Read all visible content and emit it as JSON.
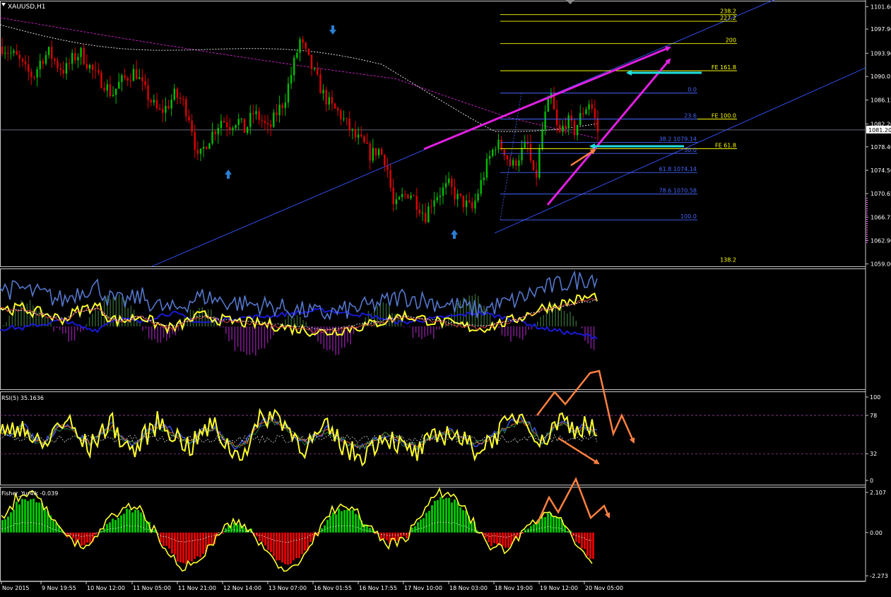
{
  "window": {
    "symbol_label": "XAUUSD,H1"
  },
  "colors": {
    "background": "#000000",
    "grid": "#ffffff",
    "bull": "#00c000",
    "bear": "#e00000",
    "fib": "#ffff00",
    "fib_retrace": "#4466ff",
    "trend": "#3355ff",
    "magenta": "#e020e0",
    "cyan": "#20e0e0",
    "orange": "#ff8040",
    "yellow_line": "#ffff00",
    "hist_green": "#00c000",
    "hist_red": "#e00000",
    "hist_purple": "#7a1a8a"
  },
  "chart_data": [
    {
      "type": "candlestick",
      "title": "XAUUSD,H1",
      "ylim": [
        1058.6,
        1102.6
      ],
      "y_ticks": [
        "1101.60",
        "1097.90",
        "1093.90",
        "1090.05",
        "1086.15",
        "1082.20",
        "1078.40",
        "1074.50",
        "1070.65",
        "1066.75",
        "1062.90",
        "1059.00"
      ],
      "current_price_label": "1081.20",
      "x_ticks": [
        "Nov 2015",
        "9 Nov 19:55",
        "10 Nov 12:00",
        "11 Nov 05:00",
        "11 Nov 21:00",
        "12 Nov 14:00",
        "13 Nov 07:00",
        "16 Nov 01:55",
        "16 Nov 17:55",
        "17 Nov 10:00",
        "18 Nov 03:00",
        "18 Nov 19:00",
        "19 Nov 12:00",
        "20 Nov 05:00"
      ],
      "close_path": [
        1095,
        1094,
        1093,
        1091,
        1090,
        1093,
        1094,
        1092,
        1091,
        1093,
        1094,
        1092,
        1090,
        1089,
        1087,
        1089,
        1090,
        1091,
        1088,
        1086,
        1084,
        1085,
        1087,
        1086,
        1083,
        1076,
        1079,
        1081,
        1083,
        1082,
        1083,
        1081,
        1084,
        1083,
        1081,
        1084,
        1086,
        1091,
        1096,
        1093,
        1090,
        1087,
        1085,
        1084,
        1082,
        1080,
        1079,
        1077,
        1078,
        1076,
        1068,
        1070,
        1071,
        1069,
        1067,
        1070,
        1071,
        1072,
        1070,
        1069,
        1068,
        1072,
        1076,
        1079,
        1078,
        1075,
        1077,
        1079,
        1072,
        1082,
        1087,
        1080,
        1083,
        1081,
        1084,
        1086,
        1081
      ],
      "fibonacci_expansion": [
        {
          "label": "238.2",
          "price": 1100.3
        },
        {
          "label": "227.2",
          "price": 1099.2
        },
        {
          "label": "200",
          "price": 1095.5
        },
        {
          "label": "FE 161.8",
          "price": 1091.0
        },
        {
          "label": "FE 100.0",
          "price": 1083.0
        },
        {
          "label": "FE 61.8",
          "price": 1078.1
        },
        {
          "label": "138.2",
          "price": 1059.1
        }
      ],
      "fibonacci_retracement": [
        {
          "label": "0.0",
          "price": 1087.3
        },
        {
          "label": "23.6",
          "price": 1083.0
        },
        {
          "label": "38.2 1079.14",
          "price": 1079.14
        },
        {
          "label": "50.0",
          "price": 1077.3
        },
        {
          "label": "61.8 1074.14",
          "price": 1074.14
        },
        {
          "label": "78.6 1070.58",
          "price": 1070.58
        },
        {
          "label": "100.0",
          "price": 1066.3
        }
      ]
    },
    {
      "type": "line",
      "title": "",
      "series": [
        {
          "name": "",
          "values": [
            71,
            68,
            70,
            66,
            64,
            60,
            58,
            66,
            70,
            72,
            60,
            56,
            58,
            62,
            55,
            50,
            48,
            54,
            60,
            62,
            58,
            56,
            55,
            54,
            53,
            52,
            50,
            48,
            47,
            45,
            44,
            46,
            48,
            50,
            52,
            55,
            58,
            62,
            60,
            58,
            56,
            54,
            52,
            50,
            48,
            50,
            53,
            56,
            60,
            65,
            70,
            72,
            75,
            78,
            80,
            82
          ]
        }
      ]
    },
    {
      "type": "line",
      "title": "RSI(5) 35.1636",
      "ylim": [
        0,
        100
      ],
      "y_ticks": [
        "100",
        "78",
        "32",
        "0"
      ],
      "levels": [
        78,
        32
      ]
    },
    {
      "type": "bar",
      "title": "Fisher_Yur4ik -0.039",
      "y_ticks": [
        "2.107",
        "0.00",
        "-2.273"
      ],
      "ylim": [
        -2.273,
        2.107
      ]
    }
  ]
}
